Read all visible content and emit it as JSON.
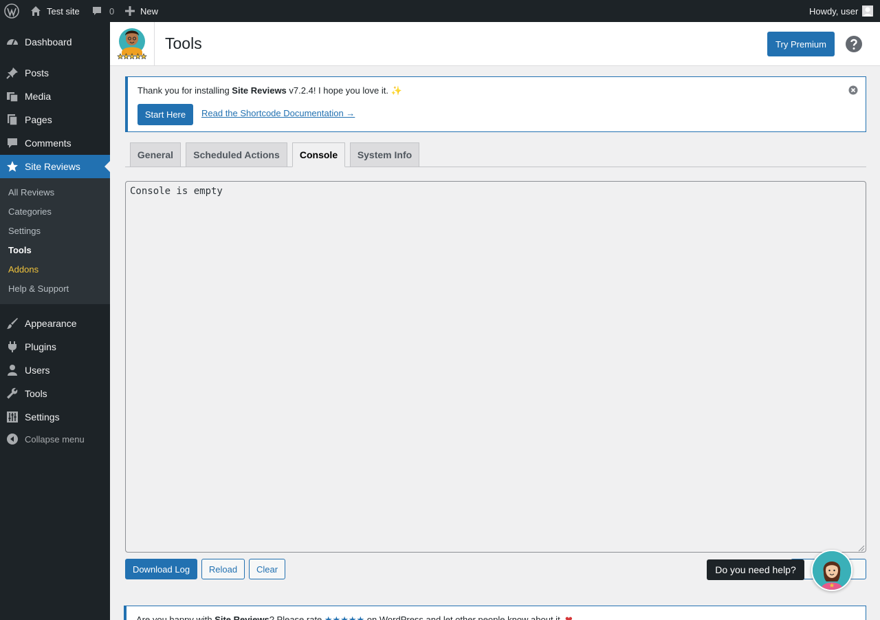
{
  "adminbar": {
    "site_name": "Test site",
    "comments_count": "0",
    "new_label": "New",
    "greeting": "Howdy, user"
  },
  "sidebar": {
    "items": [
      {
        "label": "Dashboard",
        "icon": "dashboard-icon"
      },
      {
        "label": "Posts",
        "icon": "pin-icon"
      },
      {
        "label": "Media",
        "icon": "media-icon"
      },
      {
        "label": "Pages",
        "icon": "pages-icon"
      },
      {
        "label": "Comments",
        "icon": "comment-icon"
      },
      {
        "label": "Site Reviews",
        "icon": "star-icon"
      },
      {
        "label": "Appearance",
        "icon": "brush-icon"
      },
      {
        "label": "Plugins",
        "icon": "plug-icon"
      },
      {
        "label": "Users",
        "icon": "user-icon"
      },
      {
        "label": "Tools",
        "icon": "wrench-icon"
      },
      {
        "label": "Settings",
        "icon": "sliders-icon"
      },
      {
        "label": "Collapse menu",
        "icon": "collapse-icon"
      }
    ],
    "submenu": [
      "All Reviews",
      "Categories",
      "Settings",
      "Tools",
      "Addons",
      "Help & Support"
    ]
  },
  "header": {
    "title": "Tools",
    "premium_button": "Try Premium"
  },
  "notice": {
    "text_before": "Thank you for installing ",
    "plugin_name": "Site Reviews",
    "text_after": " v7.2.4! I hope you love it. ",
    "sparkle": "✨",
    "start_button": "Start Here",
    "doc_link": "Read the Shortcode Documentation →"
  },
  "tabs": [
    "General",
    "Scheduled Actions",
    "Console",
    "System Info"
  ],
  "active_tab": "Console",
  "console": {
    "content": "Console is empty"
  },
  "buttons": {
    "download": "Download Log",
    "reload": "Reload",
    "clear": "Clear"
  },
  "help": {
    "tooltip": "Do you need help?"
  },
  "bottom_notice": {
    "before": "Are you happy with ",
    "plugin_name": "Site Reviews",
    "middle": "? Please rate ",
    "stars": "★★★★★",
    "after": " on WordPress and let other people know about it. ",
    "heart": "❤"
  },
  "colors": {
    "accent": "#2271b1",
    "adminbar_bg": "#1d2327",
    "submenu_bg": "#2c3338",
    "addons": "#f0c33c"
  }
}
